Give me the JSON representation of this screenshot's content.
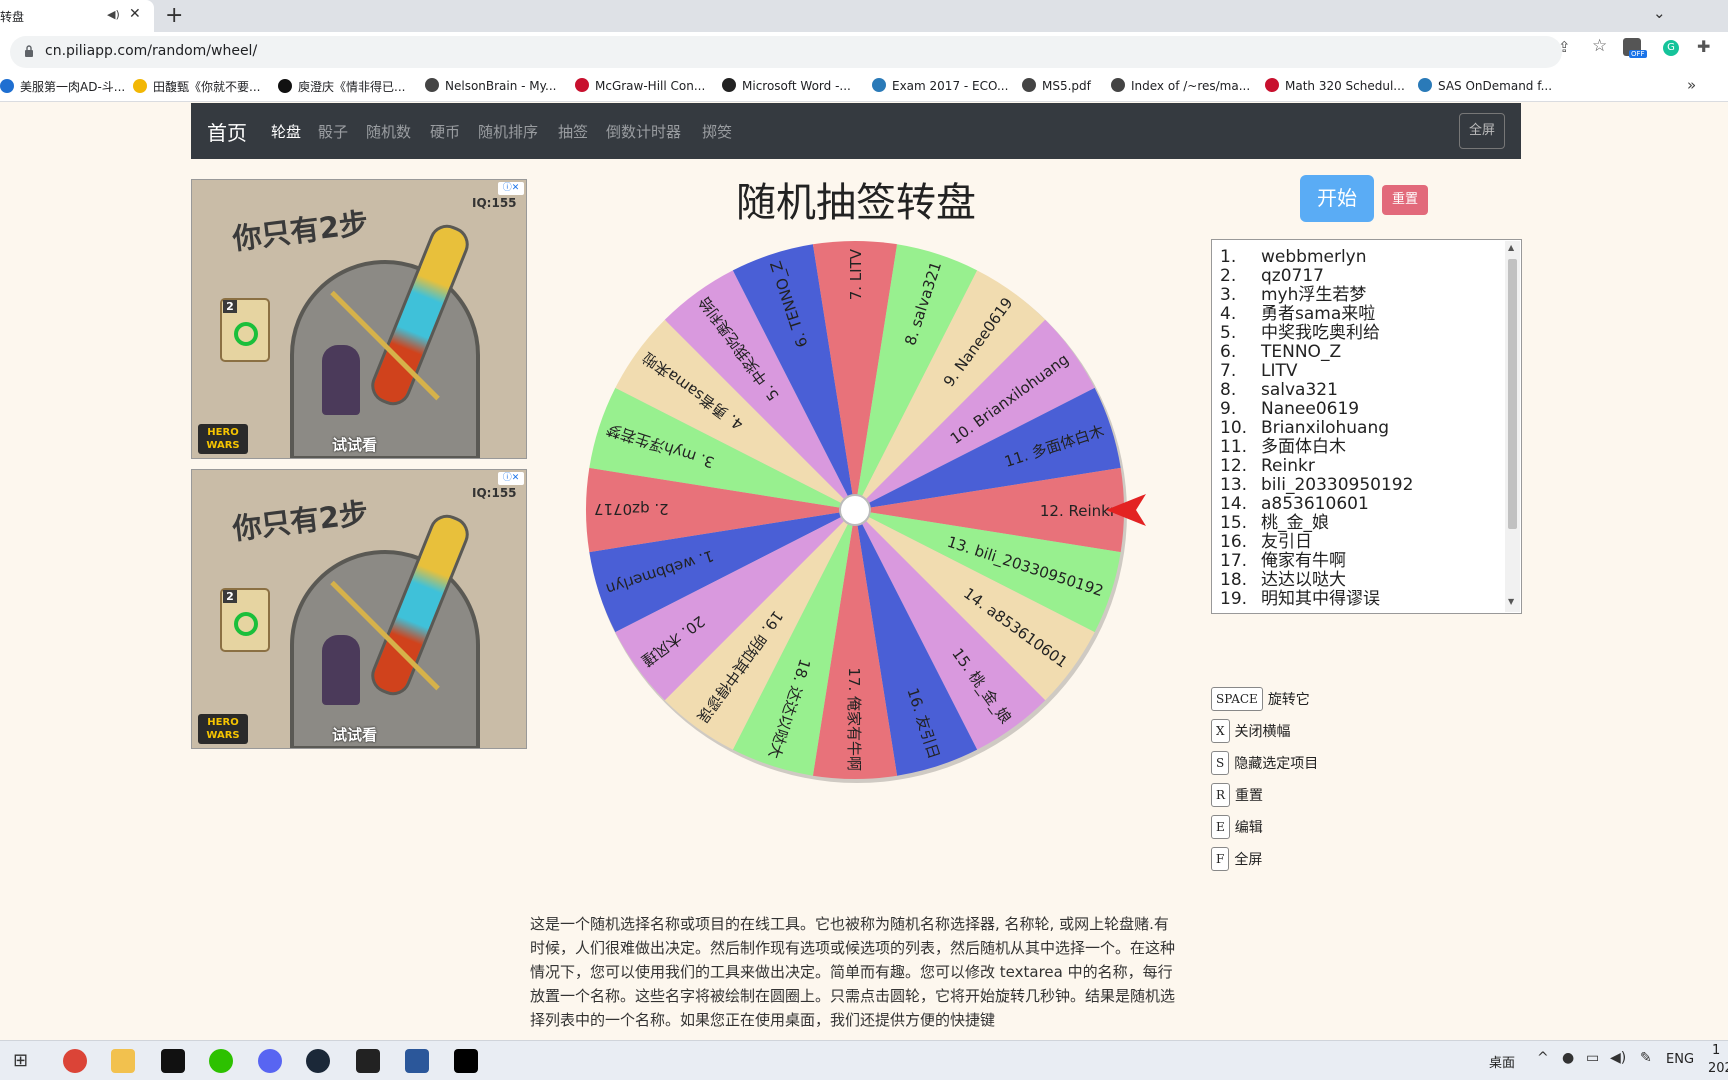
{
  "browser": {
    "tab_title": "转盘",
    "tab_audio_icon": "speaker-icon",
    "tab_close": "✕",
    "new_tab": "+",
    "url": "cn.piliapp.com/random/wheel/",
    "bookmarks": [
      {
        "label": "美服第一肉AD-斗...",
        "color": "#1f6fd1"
      },
      {
        "label": "田馥甄《你就不要...",
        "color": "#f2b705"
      },
      {
        "label": "庾澄庆《情非得已...",
        "color": "#111111"
      },
      {
        "label": "NelsonBrain - My...",
        "color": "#444444"
      },
      {
        "label": "McGraw-Hill Con...",
        "color": "#c8102e"
      },
      {
        "label": "Microsoft Word -...",
        "color": "#222222"
      },
      {
        "label": "Exam 2017 - ECO...",
        "color": "#2a7ab8"
      },
      {
        "label": "MS5.pdf",
        "color": "#444444"
      },
      {
        "label": "Index of /~res/ma...",
        "color": "#444444"
      },
      {
        "label": "Math 320 Schedul...",
        "color": "#c8102e"
      },
      {
        "label": "SAS OnDemand f...",
        "color": "#2a7ab8"
      }
    ],
    "bookmarks_more": "»"
  },
  "nav": {
    "brand": "首页",
    "items": [
      "轮盘",
      "骰子",
      "随机数",
      "硬币",
      "随机排序",
      "抽签",
      "倒数计时器",
      "掷筊"
    ],
    "fullscreen": "全屏"
  },
  "ads": [
    {
      "title": "你只有2步",
      "iq": "IQ:155",
      "card_num": "2",
      "logo": "HERO WARS",
      "cta": "试试看",
      "badge": "ⓘ✕"
    },
    {
      "title": "你只有2步",
      "iq": "IQ:155",
      "card_num": "2",
      "logo": "HERO WARS",
      "cta": "试试看",
      "badge": "ⓘ✕"
    }
  ],
  "title": "随机抽签转盘",
  "controls": {
    "start": "开始",
    "reset": "重置"
  },
  "wheel": {
    "segments": [
      "1. webbmerlyn",
      "2. qz0717",
      "3. myh浮生若梦",
      "4. 勇者sama来啦",
      "5. 中奖我吃奥利给",
      "6. TENNO_Z",
      "7. LITV",
      "8. salva321",
      "9. Nanee0619",
      "10. Brianxilohuang",
      "11. 多面体白木",
      "12. Reinkr",
      "13. bili_20330950192",
      "14. a853610601",
      "15. 桃_金_娘",
      "16. 友引日",
      "17. 俺家有牛啊",
      "18. 达达以哒大",
      "19. 明知其中得谬误",
      "20. 木风瑾"
    ],
    "colors": [
      "#4a5fd6",
      "#e8727a",
      "#98f08f",
      "#f1dcb0",
      "#d999de"
    ],
    "pointer_color": "#e32222"
  },
  "names": [
    "webbmerlyn",
    "qz0717",
    "myh浮生若梦",
    "勇者sama来啦",
    "中奖我吃奥利给",
    "TENNO_Z",
    "LITV",
    "salva321",
    "Nanee0619",
    "Brianxilohuang",
    "多面体白木",
    "Reinkr",
    "bili_20330950192",
    "a853610601",
    "桃_金_娘",
    "友引日",
    "俺家有牛啊",
    "达达以哒大",
    "明知其中得谬误"
  ],
  "shortcuts": [
    {
      "key": "SPACE",
      "label": "旋转它"
    },
    {
      "key": "X",
      "label": "关闭横幅"
    },
    {
      "key": "S",
      "label": "隐藏选定项目"
    },
    {
      "key": "R",
      "label": "重置"
    },
    {
      "key": "E",
      "label": "编辑"
    },
    {
      "key": "F",
      "label": "全屏"
    }
  ],
  "description": "这是一个随机选择名称或项目的在线工具。它也被称为随机名称选择器, 名称轮, 或网上轮盘赌.有时候，人们很难做出决定。然后制作现有选项或候选项的列表，然后随机从其中选择一个。在这种情况下，您可以使用我们的工具来做出决定。简单而有趣。您可以修改 textarea 中的名称，每行放置一个名称。这些名字将被绘制在圆圈上。只需点击圆轮，它将开始旋转几秒钟。结果是随机选择列表中的一个名称。如果您正在使用桌面，我们还提供方便的快捷键",
  "taskbar": {
    "desktop_label": "桌面",
    "lang": "ENG",
    "clock_time": "1",
    "clock_date": "202"
  }
}
